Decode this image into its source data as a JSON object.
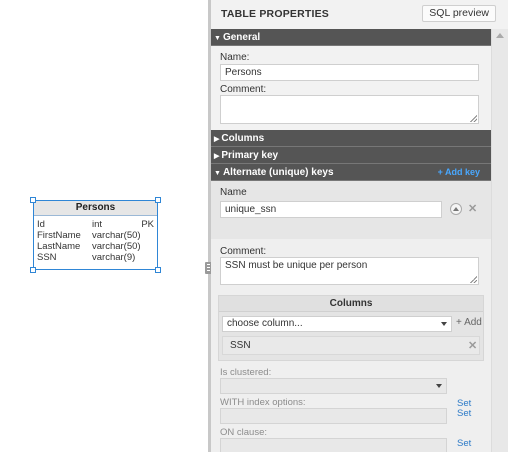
{
  "entity": {
    "title": "Persons",
    "columns": [
      {
        "name": "Id",
        "type": "int",
        "key": "PK"
      },
      {
        "name": "FirstName",
        "type": "varchar(50)",
        "key": ""
      },
      {
        "name": "LastName",
        "type": "varchar(50)",
        "key": ""
      },
      {
        "name": "SSN",
        "type": "varchar(9)",
        "key": ""
      }
    ]
  },
  "panel": {
    "title": "TABLE PROPERTIES",
    "sql_button": "SQL preview"
  },
  "general": {
    "header": "General",
    "name_label": "Name:",
    "name_value": "Persons",
    "comment_label": "Comment:",
    "comment_value": ""
  },
  "sections": {
    "columns": "Columns",
    "primary_key": "Primary key",
    "alternate_keys": "Alternate (unique) keys",
    "add_key": "+ Add key"
  },
  "alternate_key": {
    "name_label": "Name",
    "name_value": "unique_ssn",
    "comment_label": "Comment:",
    "comment_value": "SSN must be unique per person",
    "columns_header": "Columns",
    "choose_column_placeholder": "choose column...",
    "add_label": "+ Add",
    "columns": [
      "SSN"
    ],
    "is_clustered_label": "Is clustered:",
    "with_index_label": "WITH index options:",
    "on_clause_label": "ON clause:",
    "set_label": "Set"
  },
  "icons": {
    "collapsed": "caret-right-icon",
    "expanded": "caret-down-icon",
    "move_up": "arrow-up-circle-icon",
    "remove": "close-icon"
  },
  "colors": {
    "section_bg": "#555555",
    "accent_link": "#49a8ff",
    "selection": "#2f86d6",
    "set_link": "#2a79c7"
  }
}
